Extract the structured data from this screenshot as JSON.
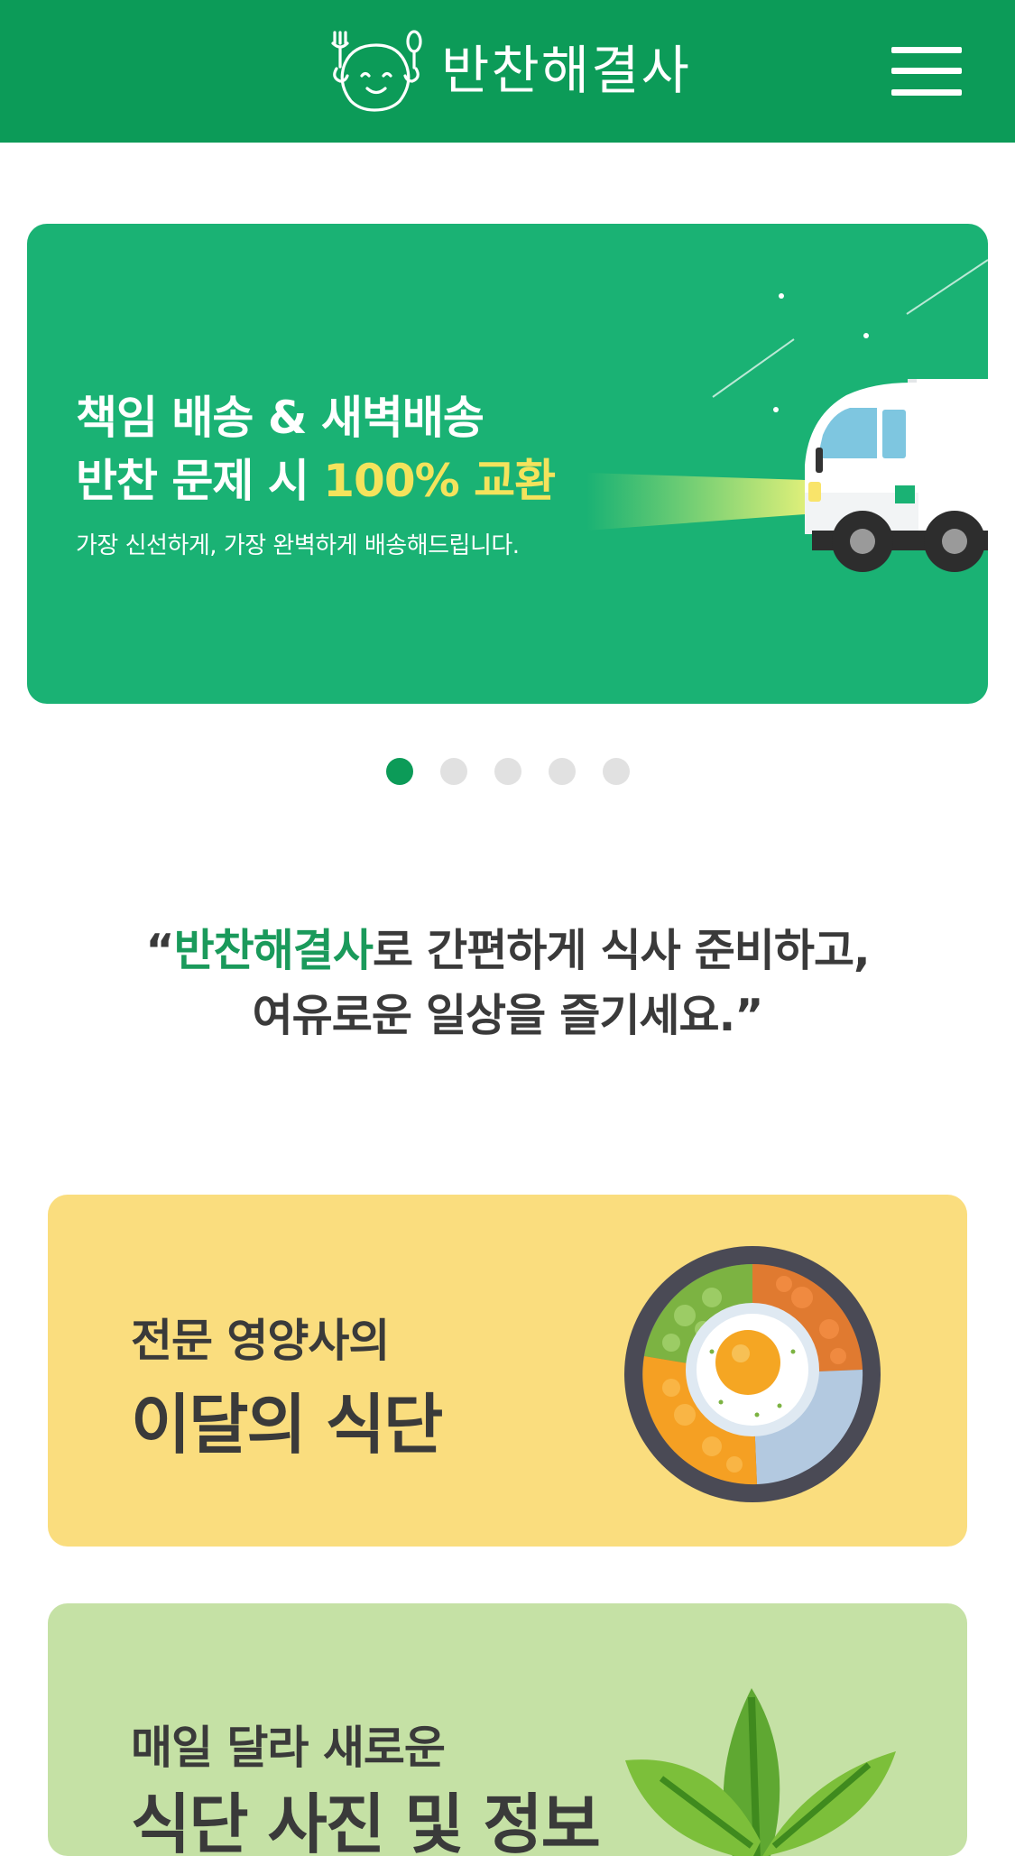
{
  "header": {
    "logo_text": "반찬해결사",
    "menu_icon": "hamburger-menu-icon",
    "background_color": "#0c9b58"
  },
  "banner": {
    "title_line1": "책임 배송 & 새벽배송",
    "title_line2_prefix": "반찬 문제 시 ",
    "title_line2_highlight": "100% 교환",
    "subtitle": "가장 신선하게, 가장 완벽하게 배송해드립니다.",
    "background_color": "#1ab274",
    "highlight_color": "#f4e35c",
    "illustration": "delivery-truck-illustration"
  },
  "pagination": {
    "total": 5,
    "active_index": 0
  },
  "quote": {
    "open_mark": "“",
    "brand": "반찬해결사",
    "line1_rest": "로 간편하게 식사 준비하고,",
    "line2": "여유로운 일상을 즐기세요.”",
    "brand_color": "#1a9a5b"
  },
  "cards": [
    {
      "small": "전문 영양사의",
      "big": "이달의 식단",
      "background_color": "#fadd7e",
      "illustration": "bibimbap-bowl-illustration"
    },
    {
      "small": "매일 달라 새로운",
      "big": "식단 사진 및 정보",
      "background_color": "#c5e1a5",
      "illustration": "leaf-sprout-illustration"
    }
  ]
}
